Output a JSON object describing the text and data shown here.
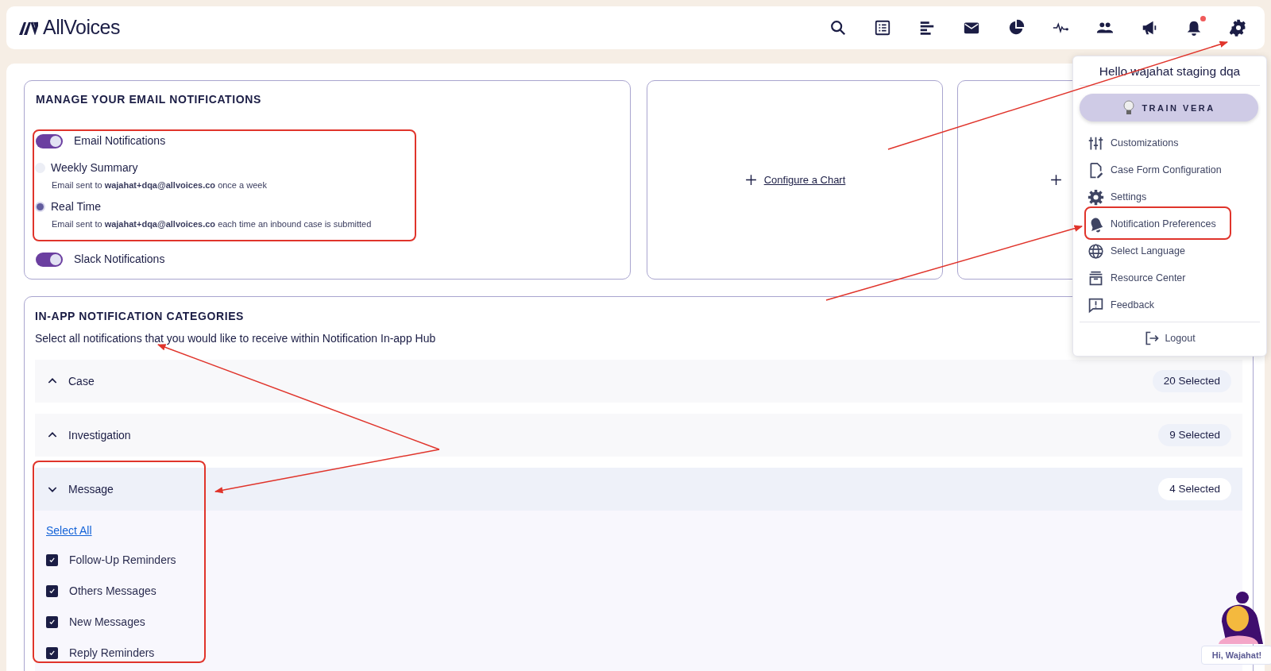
{
  "header": {
    "logo": "AllVoices",
    "bell_unread": true
  },
  "email_card": {
    "title": "MANAGE YOUR EMAIL NOTIFICATIONS",
    "email_toggle": {
      "label": "Email Notifications",
      "on": true
    },
    "frequencies": [
      {
        "label": "Weekly Summary",
        "description": "Email sent to **wajahat+dqa@allvoices.co** once a week",
        "selected": false
      },
      {
        "label": "Real Time",
        "description": "Email sent to **wajahat+dqa@allvoices.co** each time an inbound case is submitted",
        "selected": true
      }
    ],
    "slack_toggle": {
      "label": "Slack Notifications",
      "on": true
    }
  },
  "chart_cards": [
    {
      "kind": "labeled",
      "label": "Configure a Chart"
    },
    {
      "kind": "icon_only"
    }
  ],
  "categories": {
    "title": "IN-APP NOTIFICATION CATEGORIES",
    "subtitle": "Select all notifications that you would like to receive within Notification In-app Hub",
    "groups": [
      {
        "label": "Case",
        "count": "20 Selected",
        "expanded": false
      },
      {
        "label": "Investigation",
        "count": "9 Selected",
        "expanded": false
      },
      {
        "label": "Message",
        "count": "4 Selected",
        "expanded": true,
        "select_all": "Select All",
        "items": [
          {
            "label": "Follow-Up Reminders",
            "checked": true
          },
          {
            "label": "Others Messages",
            "checked": true
          },
          {
            "label": "New Messages",
            "checked": true
          },
          {
            "label": "Reply Reminders",
            "checked": true
          }
        ]
      }
    ]
  },
  "user_menu": {
    "greeting": "Hello wajahat staging dqa",
    "train_button": "TRAIN VERA",
    "items": [
      {
        "label": "Customizations"
      },
      {
        "label": "Case Form Configuration"
      },
      {
        "label": "Settings"
      },
      {
        "label": "Notification Preferences"
      },
      {
        "label": "Select Language"
      },
      {
        "label": "Resource Center"
      },
      {
        "label": "Feedback"
      }
    ],
    "logout": "Logout"
  },
  "assistant": {
    "greeting": "Hi, Wajahat!"
  }
}
